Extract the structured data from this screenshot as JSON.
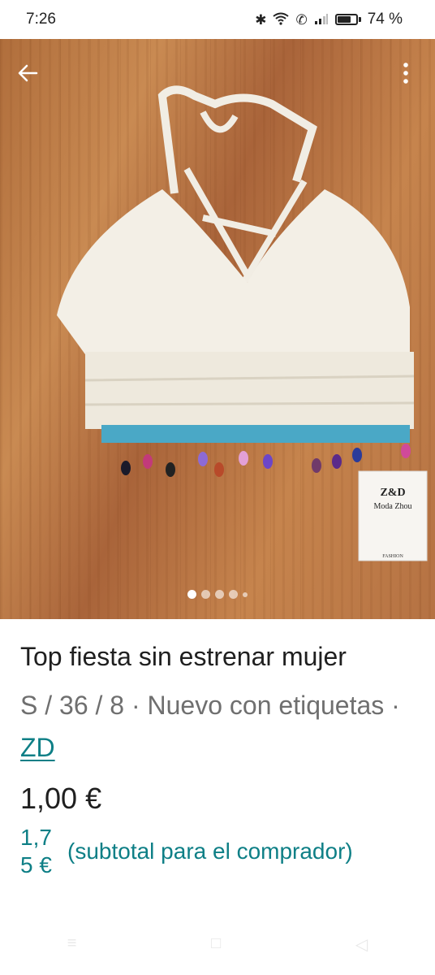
{
  "status_bar": {
    "time": "7:26",
    "battery": "74 %",
    "icons": [
      "bluetooth-icon",
      "wifi-icon",
      "call-icon",
      "signal-icon",
      "battery-icon"
    ]
  },
  "gallery": {
    "image_count": 5,
    "active_index": 0,
    "tag_brand": "Z&D",
    "tag_subtitle": "Moda Zhou",
    "tag_small": "FASHION"
  },
  "item": {
    "title": "Top fiesta sin estrenar mujer",
    "details": "S / 36 / 8 · Nuevo con etiquetas · ",
    "brand": "ZD",
    "price": "1,00 €",
    "buyer_price_line1": "1,7",
    "buyer_price_line2": "5 €",
    "buyer_note": "(subtotal para el comprador)"
  },
  "colors": {
    "accent": "#0e7f86",
    "text": "#1f1f1f",
    "muted": "#6f6f6f"
  }
}
